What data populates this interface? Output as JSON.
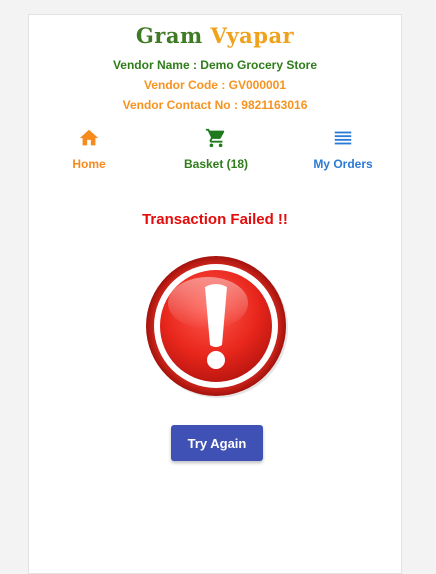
{
  "brand": {
    "word1": "Gram",
    "word2": "Vyapar",
    "color1": "#3f7b25",
    "color2": "#f0a21a"
  },
  "vendor": {
    "name_line": "Vendor Name : Demo Grocery Store",
    "code_line": "Vendor Code : GV000001",
    "contact_line": "Vendor Contact No : 9821163016"
  },
  "nav": {
    "home": {
      "label": "Home",
      "icon": "home-icon",
      "color": "#f58a1f"
    },
    "basket": {
      "label": "Basket (18)",
      "icon": "cart-icon",
      "color": "#2e7d1a"
    },
    "orders": {
      "label": "My Orders",
      "icon": "list-icon",
      "color": "#2a7ad6"
    }
  },
  "status": {
    "message": "Transaction Failed !!",
    "icon": "exclamation-alert-icon",
    "color": "#e40b0b"
  },
  "actions": {
    "retry_label": "Try Again",
    "retry_color": "#3f51b5"
  }
}
